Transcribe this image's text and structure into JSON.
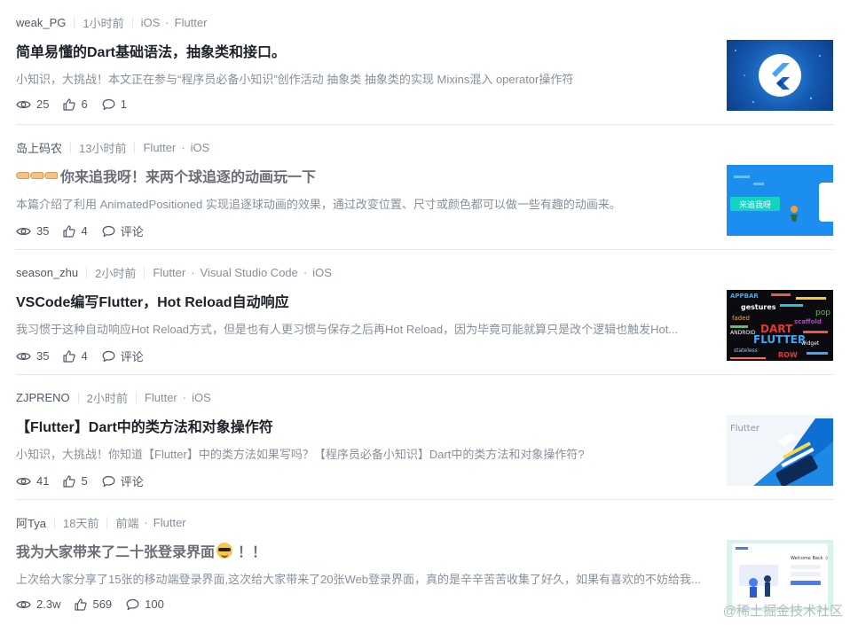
{
  "articles": [
    {
      "author": "weak_PG",
      "time": "1小时前",
      "tags": [
        "iOS",
        "Flutter"
      ],
      "title": "简单易懂的Dart基础语法，抽象类和接口。",
      "abstract": "小知识，大挑战！本文正在参与“程序员必备小知识”创作活动 抽象类  抽象类的实现 Mixins混入 operator操作符",
      "views": "25",
      "likes": "6",
      "comments": "1",
      "thumb_icon": "flutter-logo"
    },
    {
      "author": "岛上码农",
      "time": "13小时前",
      "tags": [
        "Flutter",
        "iOS"
      ],
      "title": "你来追我呀！来两个球追逐的动画玩一下",
      "abstract": "本篇介绍了利用 AnimatedPositioned 实现追逐球动画的效果，通过改变位置、尺寸或颜色都可以做一些有趣的动画来。",
      "views": "35",
      "likes": "4",
      "comments": "评论",
      "thumb_text": "来追我呀"
    },
    {
      "author": "season_zhu",
      "time": "2小时前",
      "tags": [
        "Flutter",
        "Visual Studio Code",
        "iOS"
      ],
      "title": "VSCode编写Flutter，Hot Reload自动响应",
      "abstract": "我习惯于这种自动响应Hot Reload方式，但是也有人更习惯与保存之后再Hot Reload，因为毕竟可能就算只是改个逻辑也触发Hot...",
      "views": "35",
      "likes": "4",
      "comments": "评论",
      "thumb_words": [
        "APPBAR",
        "DART",
        "FLUTTER",
        "gestures",
        "faded",
        "ROW",
        "pop",
        "ANDROID",
        "scaffold",
        "stateless",
        "widget"
      ]
    },
    {
      "author": "ZJPRENO",
      "time": "2小时前",
      "tags": [
        "Flutter",
        "iOS"
      ],
      "title": "【Flutter】Dart中的类方法和对象操作符",
      "abstract": "小知识，大挑战！你知道【Flutter】中的类方法如果写吗？【程序员必备小知识】Dart中的类方法和对象操作符?",
      "views": "41",
      "likes": "5",
      "comments": "评论",
      "thumb_text": "Flutter"
    },
    {
      "author": "阿Tya",
      "time": "18天前",
      "tags": [
        "前端",
        "Flutter"
      ],
      "title": "我为大家带来了二十张登录界面",
      "title_suffix": "！！",
      "abstract": "上次给大家分享了15张的移动端登录界面,这次给大家带来了20张Web登录界面，真的是辛辛苦苦收集了好久，如果有喜欢的不妨给我...",
      "views": "2.3w",
      "likes": "569",
      "comments": "100",
      "thumb_text": "Welcome Back :)"
    }
  ],
  "watermark": "@稀土掘金技术社区",
  "colors": {
    "title": "#1d2129",
    "muted_title": "#6b6e76",
    "meta": "#86909c",
    "divider": "#e5e6eb",
    "flutter_blue": "#1f6fcf"
  }
}
